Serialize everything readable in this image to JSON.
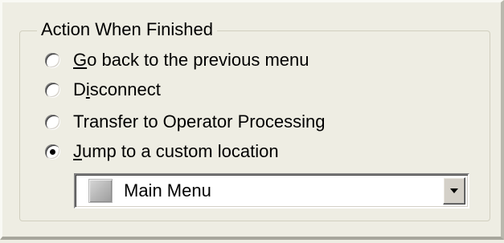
{
  "group": {
    "title": "Action When Finished"
  },
  "options": [
    {
      "label_pre": "",
      "label_accel": "G",
      "label_post": "o back to the previous menu",
      "selected": false
    },
    {
      "label_pre": "D",
      "label_accel": "i",
      "label_post": "sconnect",
      "selected": false
    },
    {
      "label_pre": "Transfer to Operator Processing",
      "label_accel": "",
      "label_post": "",
      "selected": false
    },
    {
      "label_pre": "",
      "label_accel": "J",
      "label_post": "ump to a custom location",
      "selected": true
    }
  ],
  "location_select": {
    "value": "Main Menu",
    "icon": "menu-thumbnail-icon",
    "dropdown_icon": "chevron-down-icon"
  },
  "colors": {
    "background": "#eeede3",
    "group_border": "#d1cfbf",
    "text": "#000000"
  }
}
